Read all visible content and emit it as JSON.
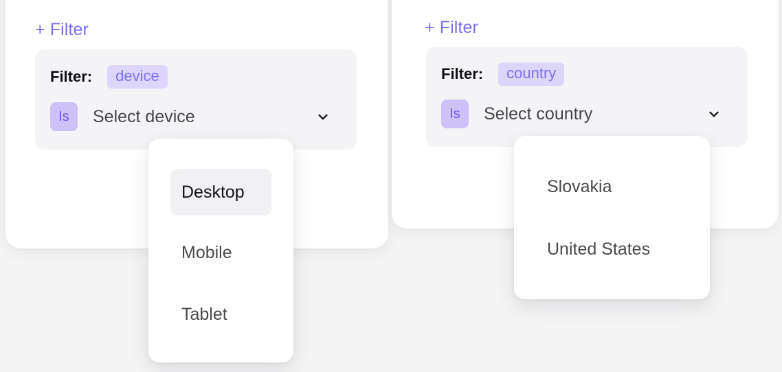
{
  "page": {
    "background_color": "#f4f4f5",
    "accent_color": "#7c6ff0"
  },
  "panels": [
    {
      "id": "device",
      "add_filter_label": "+ Filter",
      "filter_label": "Filter:",
      "field_badge": "device",
      "operator_badge": "Is",
      "select_placeholder": "Select device",
      "chevron_icon": "chevron-down-icon",
      "dropdown": {
        "open": true,
        "options": [
          {
            "label": "Desktop",
            "highlighted": true
          },
          {
            "label": "Mobile",
            "highlighted": false
          },
          {
            "label": "Tablet",
            "highlighted": false
          }
        ]
      }
    },
    {
      "id": "country",
      "add_filter_label": "+ Filter",
      "filter_label": "Filter:",
      "field_badge": "country",
      "operator_badge": "Is",
      "select_placeholder": "Select country",
      "chevron_icon": "chevron-down-icon",
      "dropdown": {
        "open": true,
        "options": [
          {
            "label": "Slovakia",
            "highlighted": false
          },
          {
            "label": "United States",
            "highlighted": false
          }
        ]
      }
    }
  ],
  "colors": {
    "accent_purple": "#7c6ff0",
    "field_badge_bg": "#ddd5fb",
    "operator_badge_bg": "#cdc1f8",
    "operator_badge_text": "#6d5ae8",
    "panel_bg": "#f4f4f6",
    "card_bg": "#ffffff",
    "option_highlight_bg": "#f1f1f3",
    "placeholder_text": "#454548"
  }
}
